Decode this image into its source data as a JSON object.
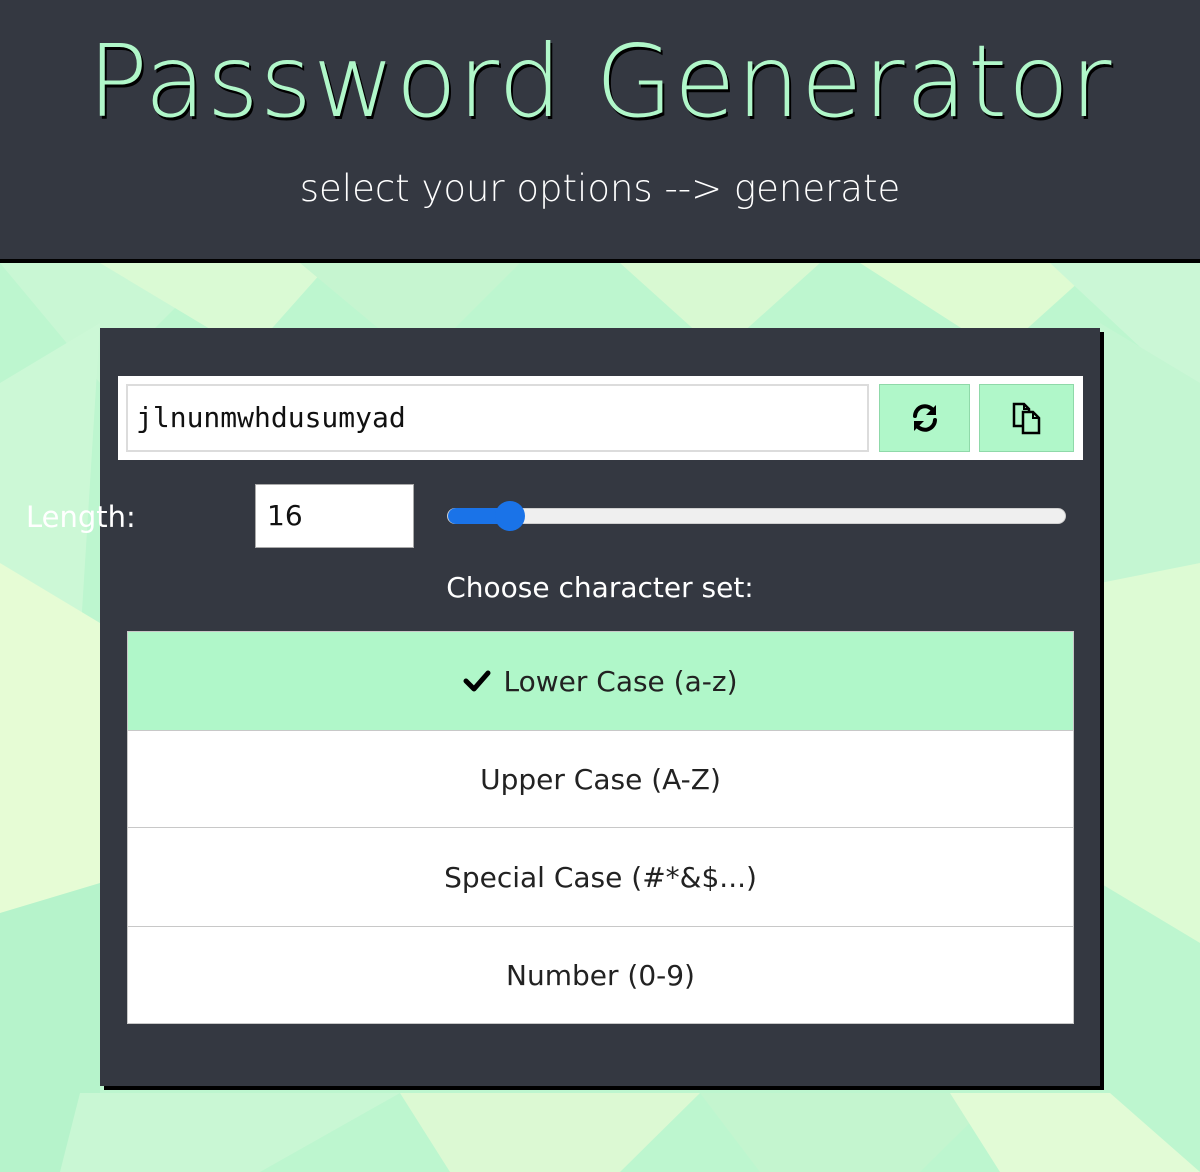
{
  "header": {
    "title": "Password Generator",
    "subtitle": "select your options --> generate"
  },
  "password": {
    "value": "jlnunmwhdusumyad",
    "refresh_icon": "refresh-icon",
    "copy_icon": "copy-icon"
  },
  "length": {
    "label": "Length:",
    "value": "16",
    "slider_fraction": 0.1
  },
  "charset": {
    "title": "Choose character set:",
    "options": [
      {
        "label": "Lower Case (a-z)",
        "selected": true
      },
      {
        "label": "Upper Case (A-Z)",
        "selected": false
      },
      {
        "label": "Special Case (#*&$...)",
        "selected": false
      },
      {
        "label": "Number (0-9)",
        "selected": false
      }
    ],
    "check_icon": "check-icon"
  },
  "colors": {
    "dark": "#343841",
    "accent": "#b0f7c9",
    "slider": "#1a73e8"
  }
}
